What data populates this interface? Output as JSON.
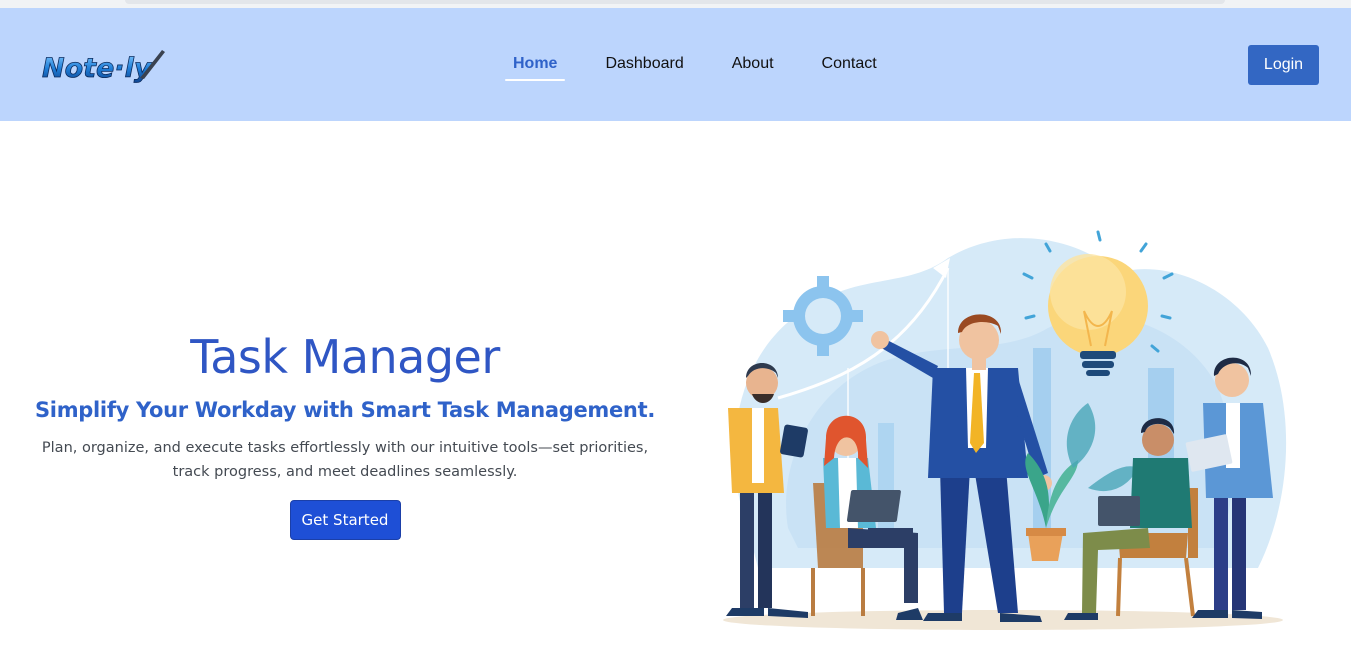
{
  "nav": {
    "brand": "Note·ly",
    "links": [
      {
        "label": "Home",
        "active": true
      },
      {
        "label": "Dashboard",
        "active": false
      },
      {
        "label": "About",
        "active": false
      },
      {
        "label": "Contact",
        "active": false
      }
    ],
    "login_label": "Login"
  },
  "hero": {
    "title": "Task Manager",
    "subtitle": "Simplify Your Workday with Smart Task Management.",
    "description": "Plan, organize, and execute tasks effortlessly with our intuitive tools—set priorities, track progress, and meet deadlines seamlessly.",
    "cta_label": "Get Started"
  },
  "colors": {
    "navbar_bg": "#bcd5fd",
    "accent": "#2f62c9",
    "login_bg": "#3367c3",
    "cta_bg": "#1e4fd6"
  },
  "illustration": {
    "icons": [
      "gear-icon",
      "lightbulb-icon",
      "growth-arrow-icon",
      "plant-icon"
    ]
  }
}
